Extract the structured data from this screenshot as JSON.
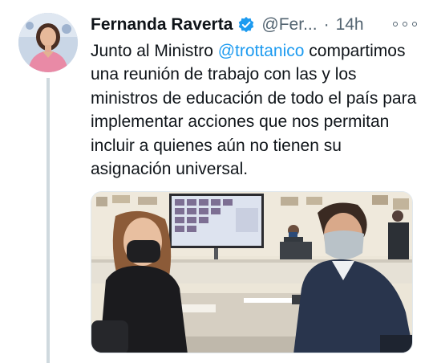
{
  "tweet": {
    "display_name": "Fernanda Raverta",
    "handle": "@Fer...",
    "separator": "·",
    "time": "14h",
    "text_intro": "Junto al Ministro ",
    "mention": "@trottanico",
    "text_body": "compartimos una reunión de trabajo con las y los ministros de educación de todo el país para implementar acciones que nos permitan incluir a quienes aún no tienen su asignación universal."
  },
  "icons": {
    "verified": "verified-badge-icon",
    "more": "more-options-icon"
  },
  "colors": {
    "link": "#1d9bf0",
    "text": "#0f1419",
    "secondary": "#536471",
    "verified": "#1d9bf0",
    "thread_line": "#cfd9de"
  }
}
